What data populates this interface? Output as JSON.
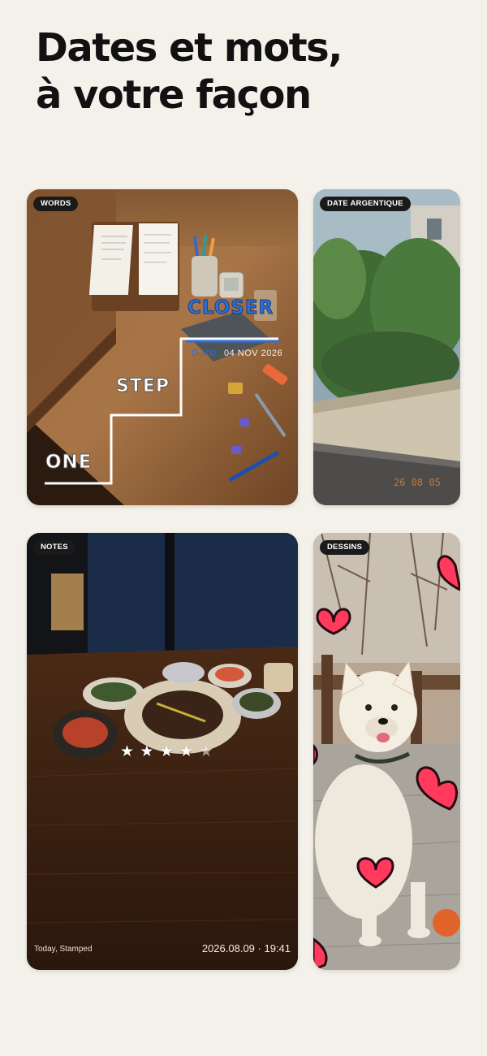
{
  "headline": {
    "line1": "Dates et mots,",
    "line2": "à votre façon"
  },
  "cards": {
    "words": {
      "tag": "WORDS",
      "closer_text": "CLOSER",
      "dday_text": "D-100",
      "date_text": "04 NOV 2026",
      "step_text": "STEP",
      "one_text": "ONE"
    },
    "date_argentique": {
      "tag": "DATE ARGENTIQUE",
      "film_date": "26 08 05"
    },
    "notes": {
      "tag": "NOTES",
      "rating": 4.5,
      "stars": [
        "★",
        "★",
        "★",
        "★",
        "★"
      ],
      "footer_left": "Today, Stamped",
      "footer_right": "2026.08.09 · 19:41"
    },
    "dessins": {
      "tag": "DESSINS"
    }
  },
  "colors": {
    "background": "#f4f1ea",
    "tag_bg": "#1a1a1a",
    "closer_blue": "#2f6fd8",
    "film_orange": "#e08a3a",
    "heart_pink": "#ff3a5c"
  }
}
